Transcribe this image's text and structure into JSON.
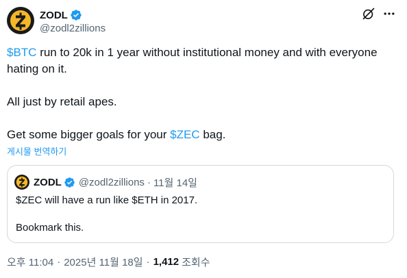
{
  "author": {
    "display_name": "ZODL",
    "handle": "@zodl2zillions",
    "avatar_icon": "zcash-logo-icon",
    "verified_icon": "verified-badge-icon"
  },
  "header_actions": {
    "grok_icon": "grok-icon",
    "more_icon": "more-options-icon"
  },
  "tweet": {
    "line1": {
      "cashtag": "$BTC",
      "text": " run to 20k in 1 year without institutional money and with everyone hating on it."
    },
    "line2": "All just by retail apes.",
    "line3": {
      "before": "Get some bigger goals for your ",
      "cashtag": "$ZEC",
      "after": " bag."
    }
  },
  "translate_label": "게시물 번역하기",
  "quote": {
    "display_name": "ZODL",
    "handle": "@zodl2zillions",
    "separator": "·",
    "date": "11월 14일",
    "line1": "$ZEC will have a run like $ETH in 2017.",
    "line2": "Bookmark this."
  },
  "meta": {
    "time": "오후 11:04",
    "separator": "·",
    "date": "2025년 11월 18일",
    "views_count": "1,412",
    "views_label": "조회수"
  },
  "colors": {
    "accent": "#1d9bf0",
    "text": "#0f1419",
    "secondary": "#536471",
    "border": "#cfd9de",
    "logo_bg": "#1a1a1a",
    "logo_gold": "#f4b728"
  }
}
